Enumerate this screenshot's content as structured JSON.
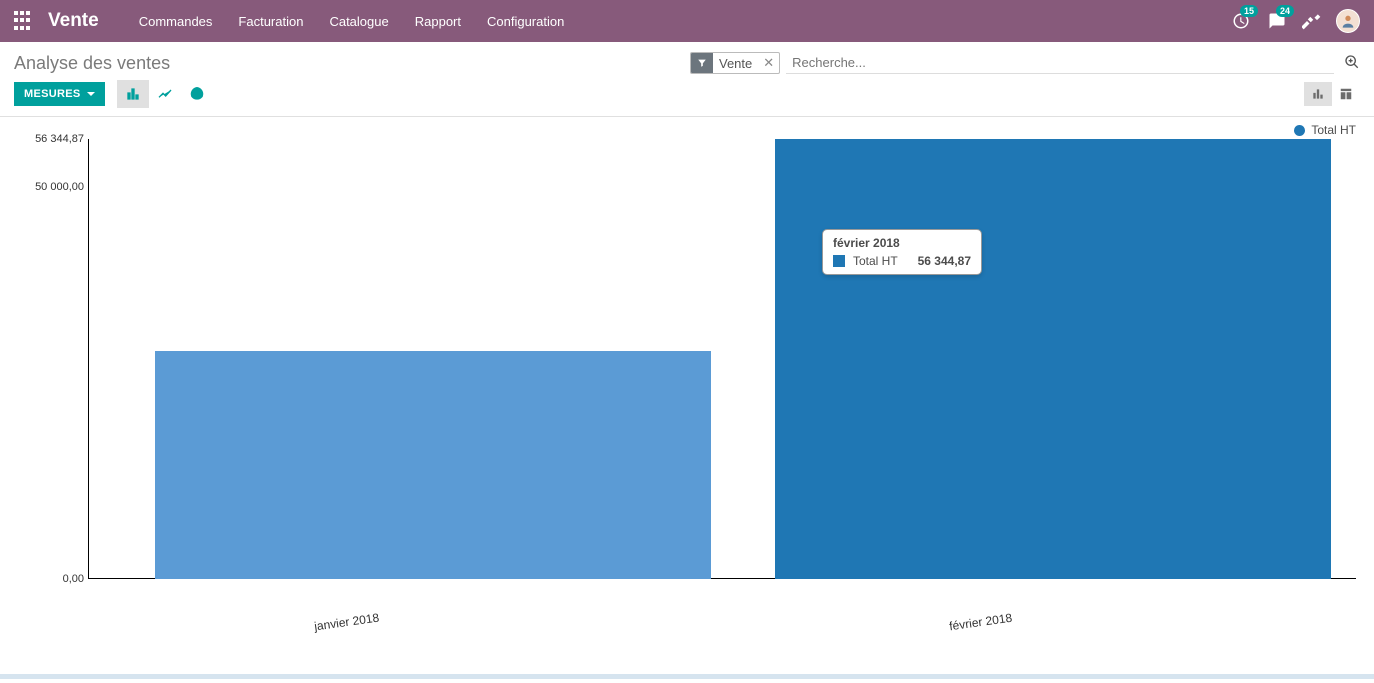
{
  "topnav": {
    "brand": "Vente",
    "menu": [
      "Commandes",
      "Facturation",
      "Catalogue",
      "Rapport",
      "Configuration"
    ],
    "badge_mail": "15",
    "badge_chat": "24"
  },
  "page": {
    "title": "Analyse des ventes"
  },
  "search": {
    "facet_value": "Vente",
    "placeholder": "Recherche..."
  },
  "buttons": {
    "measures": "MESURES"
  },
  "legend": {
    "label": "Total HT"
  },
  "tooltip": {
    "title": "février 2018",
    "series": "Total HT",
    "value": "56 344,87"
  },
  "yticks": {
    "top": "56 344,87",
    "mid": "50 000,00",
    "zero": "0,00"
  },
  "xticks": {
    "jan": "janvier 2018",
    "feb": "février 2018"
  },
  "chart_data": {
    "type": "bar",
    "title": "Analyse des ventes",
    "xlabel": "",
    "ylabel": "",
    "categories": [
      "janvier 2018",
      "février 2018"
    ],
    "series": [
      {
        "name": "Total HT",
        "values": [
          29200,
          56344.87
        ]
      }
    ],
    "ylim": [
      0,
      56344.87
    ],
    "yticks": [
      0,
      50000,
      56344.87
    ]
  }
}
